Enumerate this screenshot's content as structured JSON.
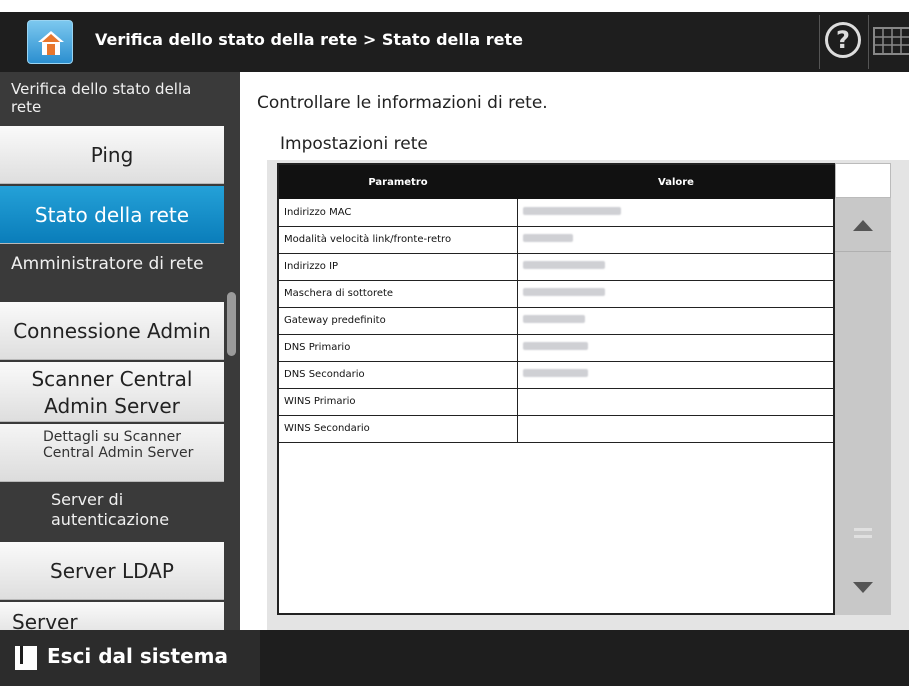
{
  "header": {
    "title": "Verifica dello stato della rete > Stato della rete",
    "home_icon": "home-icon",
    "help_label": "?"
  },
  "sidebar": {
    "section_network": "Verifica dello stato della rete",
    "ping": "Ping",
    "network_status": "Stato della rete",
    "section_admin": "Amministratore di rete",
    "admin_connection": "Connessione Admin",
    "scanner_central": "Scanner Central Admin Server",
    "scanner_details": "Dettagli su Scanner Central Admin Server",
    "section_auth": "Server di autenticazione",
    "ldap": "Server LDAP",
    "server_partial": "Server"
  },
  "main": {
    "intro": "Controllare le informazioni di rete.",
    "section_title": "Impostazioni rete",
    "table": {
      "headers": [
        "Parametro",
        "Valore"
      ],
      "rows": [
        {
          "param": "Indirizzo MAC",
          "value_blurred": true
        },
        {
          "param": "Modalità velocità link/fronte-retro",
          "value_blurred": true
        },
        {
          "param": "Indirizzo IP",
          "value_blurred": true
        },
        {
          "param": "Maschera di sottorete",
          "value_blurred": true
        },
        {
          "param": "Gateway predefinito",
          "value_blurred": true
        },
        {
          "param": "DNS Primario",
          "value_blurred": true
        },
        {
          "param": "DNS Secondario",
          "value_blurred": true
        },
        {
          "param": "WINS Primario",
          "value_blurred": false
        },
        {
          "param": "WINS Secondario",
          "value_blurred": false
        }
      ]
    }
  },
  "footer": {
    "logout": "Esci dal sistema"
  }
}
